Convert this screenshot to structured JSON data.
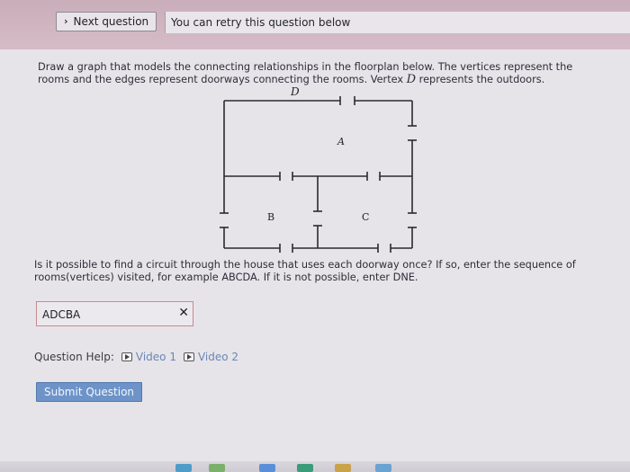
{
  "header": {
    "next_question_label": "Next question",
    "retry_message": "You can retry this question below"
  },
  "prompt": {
    "text_before_d": "Draw a graph that models the connecting relationships in the floorplan below. The vertices represent the rooms and the edges represent doorways connecting the rooms. Vertex ",
    "vertex_d": "D",
    "text_after_d": " represents the outdoors."
  },
  "floorplan": {
    "label_d": "D",
    "label_a": "A",
    "label_b": "B",
    "label_c": "C"
  },
  "question": {
    "text": "Is it possible to find a circuit through the house that uses each doorway once? If so, enter the sequence of rooms(vertices) visited, for example ABCDA. If it is not possible, enter DNE."
  },
  "answer": {
    "value": "ADCBA",
    "status_mark": "✕"
  },
  "help": {
    "label": "Question Help:",
    "video1": "Video 1",
    "video2": "Video 2"
  },
  "submit_label": "Submit Question",
  "colors": {
    "header_bg": "#c9aeb9",
    "content_bg": "#e6e4e9",
    "submit_bg": "#6d93c8",
    "answer_border": "#c48a8c",
    "link": "#6b86b5"
  }
}
